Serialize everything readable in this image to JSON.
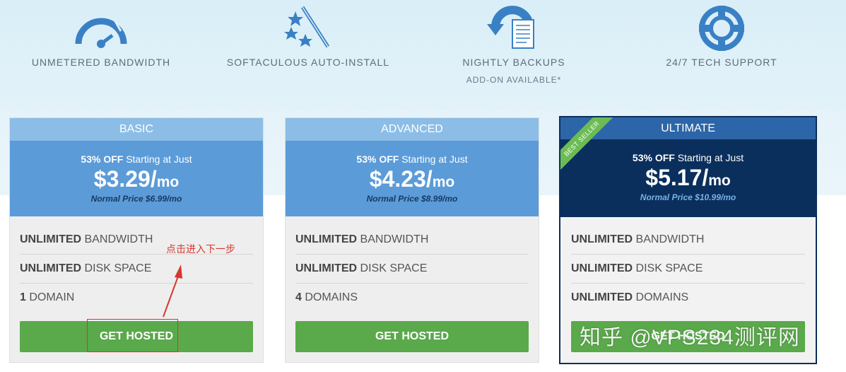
{
  "features": [
    {
      "label": "UNMETERED BANDWIDTH",
      "icon": "speedometer-icon"
    },
    {
      "label": "SOFTACULOUS AUTO-INSTALL",
      "icon": "magic-wand-stars-icon"
    },
    {
      "label": "NIGHTLY BACKUPS",
      "sublabel": "ADD-ON AVAILABLE*",
      "icon": "backup-document-icon"
    },
    {
      "label": "24/7 TECH SUPPORT",
      "icon": "lifebuoy-icon"
    }
  ],
  "plans": [
    {
      "name": "BASIC",
      "discount": "53% OFF",
      "starting_text": "Starting at Just",
      "price": "$3.29/",
      "price_unit": "mo",
      "normal_price": "Normal Price $6.99/mo",
      "features": [
        {
          "bold": "UNLIMITED",
          "text": " BANDWIDTH"
        },
        {
          "bold": "UNLIMITED",
          "text": " DISK SPACE"
        },
        {
          "bold": "1",
          "text": " DOMAIN"
        }
      ],
      "cta": "GET HOSTED"
    },
    {
      "name": "ADVANCED",
      "discount": "53% OFF",
      "starting_text": "Starting at Just",
      "price": "$4.23/",
      "price_unit": "mo",
      "normal_price": "Normal Price $8.99/mo",
      "features": [
        {
          "bold": "UNLIMITED",
          "text": " BANDWIDTH"
        },
        {
          "bold": "UNLIMITED",
          "text": " DISK SPACE"
        },
        {
          "bold": "4",
          "text": " DOMAINS"
        }
      ],
      "cta": "GET HOSTED"
    },
    {
      "name": "ULTIMATE",
      "ribbon": "BEST SELLER",
      "discount": "53% OFF",
      "starting_text": "Starting at Just",
      "price": "$5.17/",
      "price_unit": "mo",
      "normal_price": "Normal Price $10.99/mo",
      "features": [
        {
          "bold": "UNLIMITED",
          "text": " BANDWIDTH"
        },
        {
          "bold": "UNLIMITED",
          "text": " DISK SPACE"
        },
        {
          "bold": "UNLIMITED",
          "text": " DOMAINS"
        }
      ],
      "cta": "GET HOSTED"
    }
  ],
  "annotation": {
    "text": "点击进入下一步",
    "color": "#d8362f"
  },
  "watermark": "知乎 @VPS234测评网",
  "colors": {
    "cta_green": "#5aa94b",
    "basic_header": "#8cbde6",
    "basic_price": "#5b9bd8",
    "ultimate_header": "#2d66a8",
    "ultimate_price": "#0b2f5c",
    "icon_blue": "#3a80c4"
  }
}
